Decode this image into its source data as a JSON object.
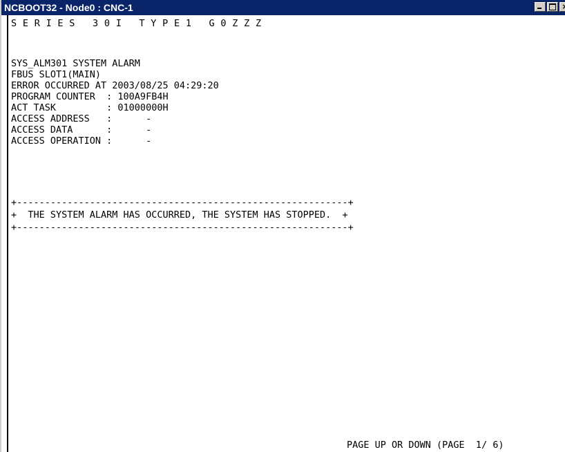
{
  "window": {
    "title": "NCBOOT32 - Node0 : CNC-1",
    "close_glyph": "×"
  },
  "screen": {
    "header": "S E R I E S   3 0 I   T Y P E 1   G 0 Z Z Z",
    "alarm_lines": [
      "SYS_ALM301 SYSTEM ALARM",
      "FBUS SLOT1(MAIN)",
      "ERROR OCCURRED AT 2003/08/25 04:29:20",
      "PROGRAM COUNTER  : 100A9FB4H",
      "ACT TASK         : 01000000H",
      "ACCESS ADDRESS   :      -",
      "ACCESS DATA      :      -",
      "ACCESS OPERATION :      -"
    ],
    "box_top": "+-----------------------------------------------------------+",
    "box_message": "+  THE SYSTEM ALARM HAS OCCURRED, THE SYSTEM HAS STOPPED.  +",
    "box_bottom": "+-----------------------------------------------------------+",
    "footer": "PAGE UP OR DOWN (PAGE  1/ 6)"
  }
}
